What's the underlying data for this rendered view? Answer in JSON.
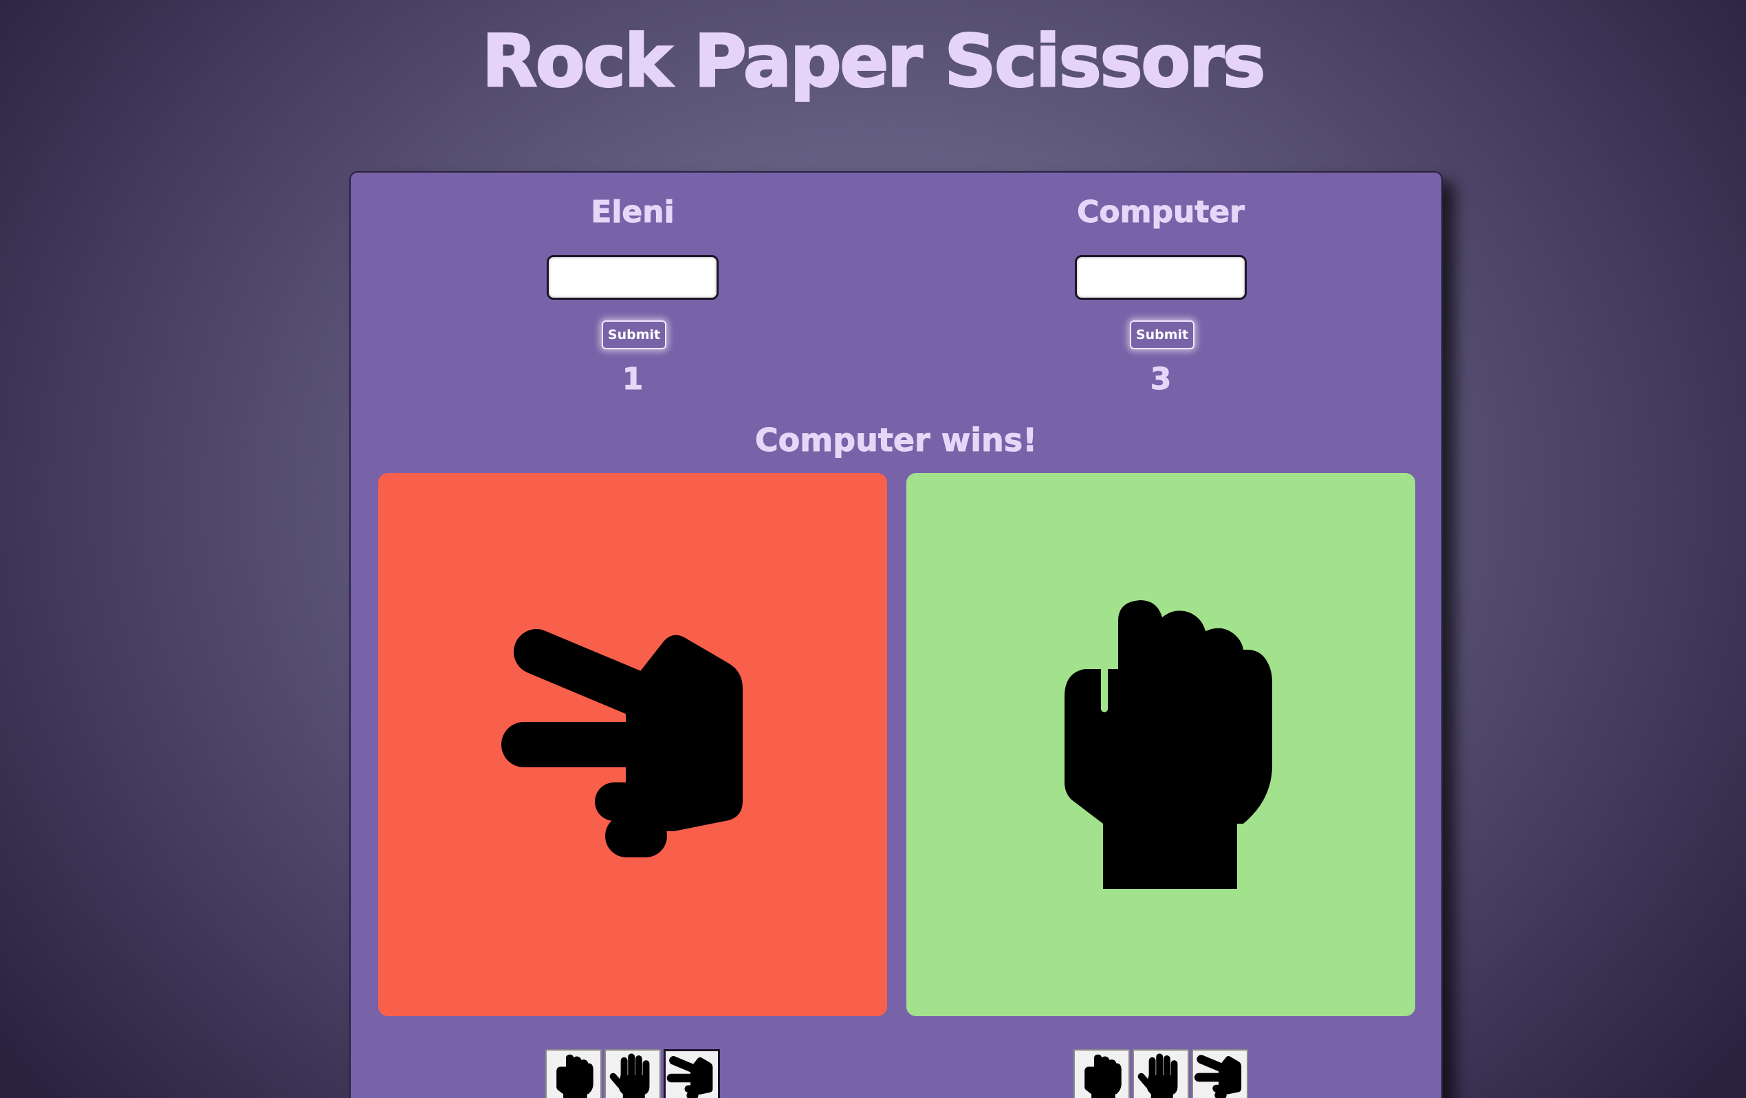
{
  "app": {
    "title": "Rock Paper Scissors"
  },
  "players": [
    {
      "name": "Eleni",
      "input_value": "",
      "submit_label": "Submit",
      "score": "1",
      "shown_choice": "scissors-hand-icon",
      "panel_color": "#f8604c",
      "selected_choice": "scissors"
    },
    {
      "name": "Computer",
      "input_value": "",
      "submit_label": "Submit",
      "score": "3",
      "shown_choice": "rock-hand-icon",
      "panel_color": "#a3e28c",
      "selected_choice": ""
    }
  ],
  "result": {
    "text": "Computer wins!"
  },
  "choice_buttons": [
    {
      "icon": "rock-hand-icon"
    },
    {
      "icon": "paper-hand-icon"
    },
    {
      "icon": "scissors-hand-icon"
    }
  ],
  "colors": {
    "board": "#7862a8",
    "text": "#e8d6f8",
    "loser": "#f8604c",
    "winner": "#a3e28c"
  }
}
